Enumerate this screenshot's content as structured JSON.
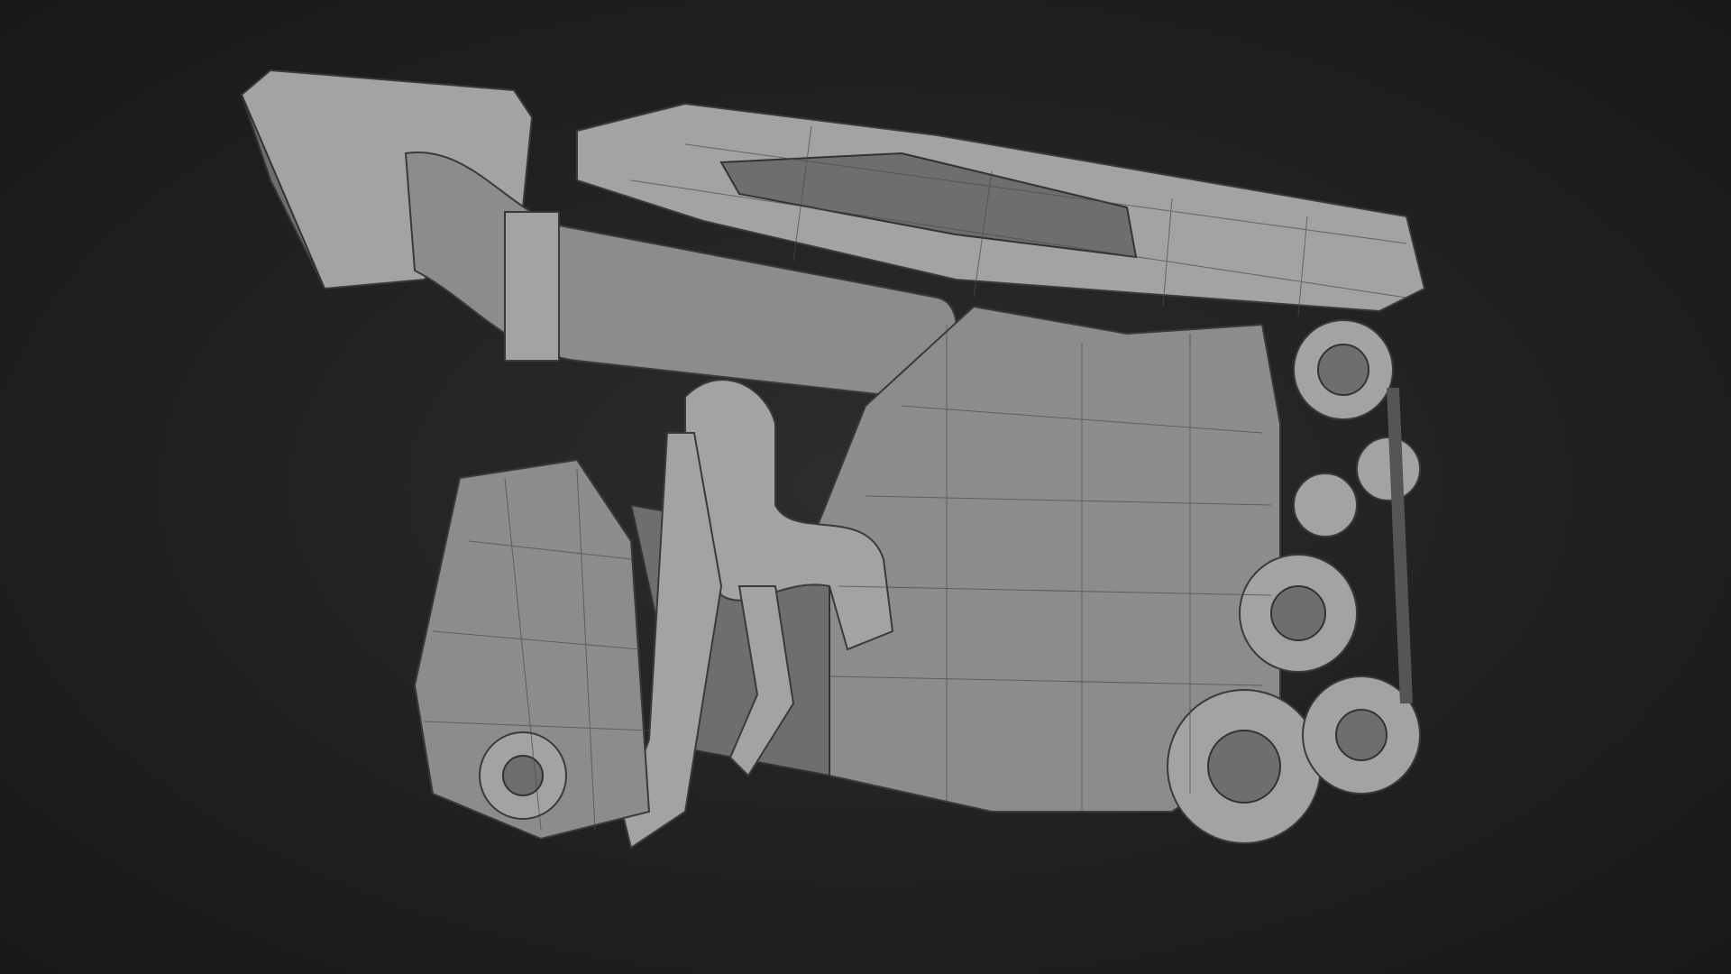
{
  "scene": {
    "subject": "engine-wireframe-render",
    "colors": {
      "background": "#1f2020",
      "model": "#8c8c8c",
      "wire": "#3a3a3a"
    }
  }
}
